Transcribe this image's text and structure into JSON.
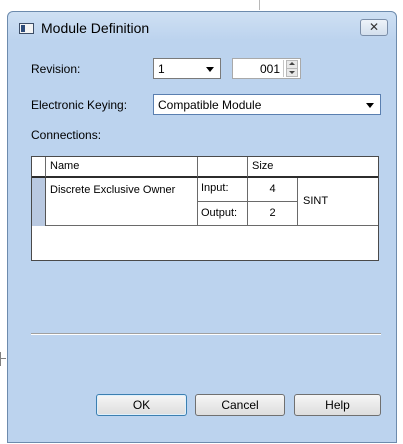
{
  "dialog": {
    "title": "Module Definition",
    "close_glyph": "✕"
  },
  "revision": {
    "label": "Revision:",
    "major": "1",
    "minor": "001"
  },
  "keying": {
    "label": "Electronic Keying:",
    "value": "Compatible Module"
  },
  "connections": {
    "label": "Connections:",
    "headers": [
      "Name",
      "",
      "Size",
      ""
    ],
    "row": {
      "name": "Discrete Exclusive Owner",
      "input_label": "Input:",
      "input_size": "4",
      "output_label": "Output:",
      "output_size": "2",
      "type": "SINT"
    }
  },
  "buttons": {
    "ok": "OK",
    "cancel": "Cancel",
    "help": "Help"
  }
}
